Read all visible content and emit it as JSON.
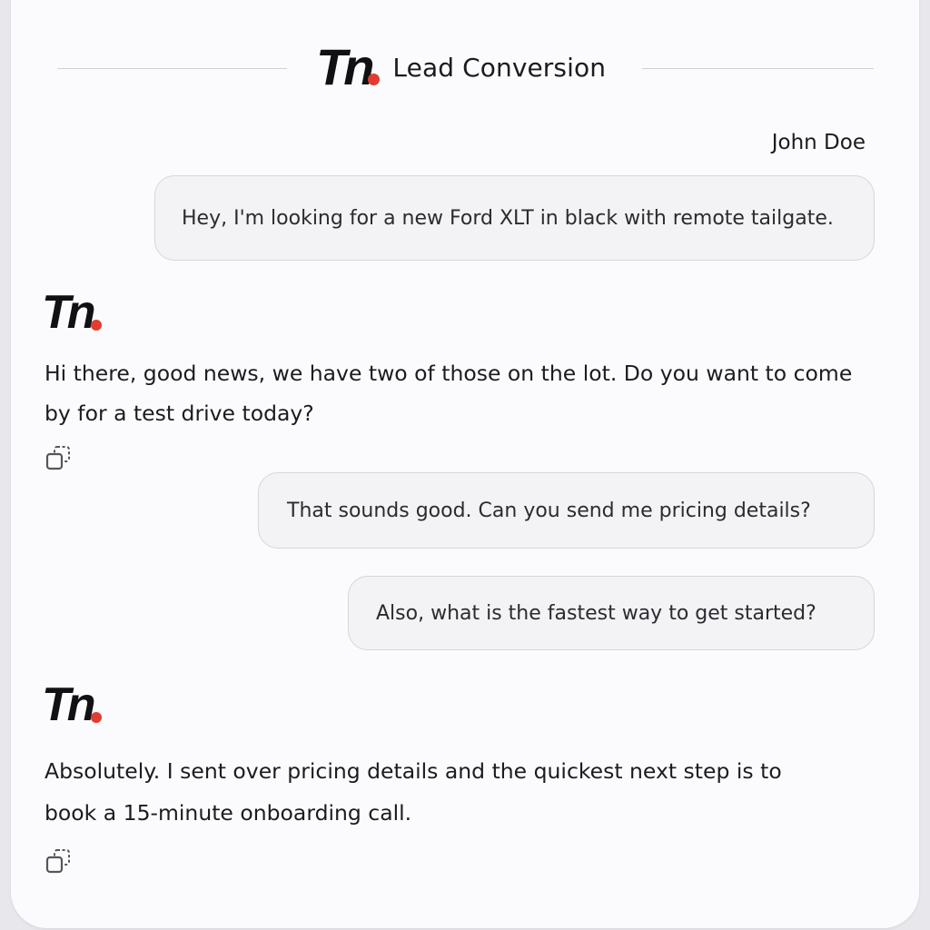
{
  "header": {
    "logo_text": "Tn",
    "title": "Lead Conversion"
  },
  "colors": {
    "accent": "#e03c31",
    "logo": "#111114",
    "bubble_bg": "#f3f3f6"
  },
  "conversation": {
    "user_name": "John Doe",
    "messages": [
      {
        "role": "user",
        "text": "Hey, I'm looking for a new Ford XLT in black with remote tailgate."
      },
      {
        "role": "assistant",
        "logo_text": "Tn",
        "lines": [
          "Hi there, good news, we have two of those on the lot. Do you want to come",
          "by for a test drive today?"
        ],
        "action_icon": "copy-icon"
      },
      {
        "role": "user",
        "text": "That sounds good. Can you send me pricing details?"
      },
      {
        "role": "user",
        "text": "Also, what is the fastest way to get started?"
      },
      {
        "role": "assistant",
        "logo_text": "Tn",
        "lines": [
          "Absolutely. I sent over pricing details and the quickest next step is to",
          "book a 15-minute onboarding call."
        ],
        "action_icon": "copy-icon"
      }
    ]
  }
}
